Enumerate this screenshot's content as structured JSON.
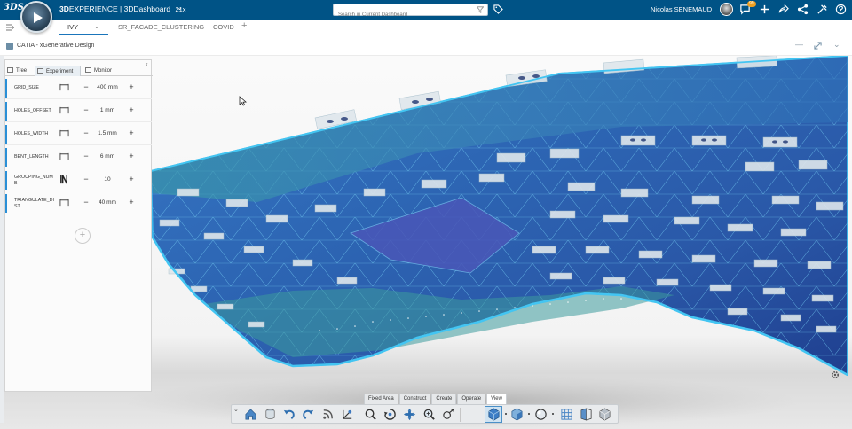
{
  "topbar": {
    "brand_logo": "3DS",
    "brand_bold": "3D",
    "app_title_rest": "EXPERIENCE | 3DDashboard",
    "app_version": "21x",
    "search_placeholder": "Search in Current Dashboard",
    "user_name": "Nicolas SENEMAUD",
    "notification_count": "99",
    "icons": [
      "compass-icon",
      "filter-icon",
      "tag-icon",
      "avatar",
      "notification-icon",
      "add-icon",
      "share-icon",
      "network-icon",
      "tools-icon",
      "help-icon"
    ]
  },
  "tabs": [
    {
      "label": "IVY",
      "active": true
    },
    {
      "label": "SR_FACADE_CLUSTERING",
      "active": false
    },
    {
      "label": "COVID",
      "active": false
    }
  ],
  "app_header": {
    "title": "CATIA - xGenerative Design"
  },
  "panel": {
    "tabs": [
      {
        "label": "Tree",
        "active": false
      },
      {
        "label": "Experiment",
        "active": true
      },
      {
        "label": "Monitor",
        "active": false
      }
    ],
    "parameters": [
      {
        "name": "GRID_SIZE",
        "value": "400 mm",
        "type": "length"
      },
      {
        "name": "HOLES_OFFSET",
        "value": "1 mm",
        "type": "length"
      },
      {
        "name": "HOLES_WIDTH",
        "value": "1.5 mm",
        "type": "length"
      },
      {
        "name": "BENT_LENGTH",
        "value": "6 mm",
        "type": "length"
      },
      {
        "name": "GROUPING_NUMB",
        "value": "10",
        "type": "integer"
      },
      {
        "name": "TRIANGULATE_DIST",
        "value": "40 mm",
        "type": "length"
      }
    ]
  },
  "action_bar": {
    "tabs": [
      {
        "label": "Fixed Area",
        "active": false
      },
      {
        "label": "Construct",
        "active": false
      },
      {
        "label": "Create",
        "active": false
      },
      {
        "label": "Operate",
        "active": false
      },
      {
        "label": "View",
        "active": true
      }
    ]
  },
  "colors": {
    "topbar": "#005386",
    "accent": "#1a75bb",
    "param_marker": "#2a8fd6",
    "mesh_blue": "#2f5fc4",
    "mesh_teal": "#3aa8a8",
    "mesh_edge": "#39b4e8"
  }
}
